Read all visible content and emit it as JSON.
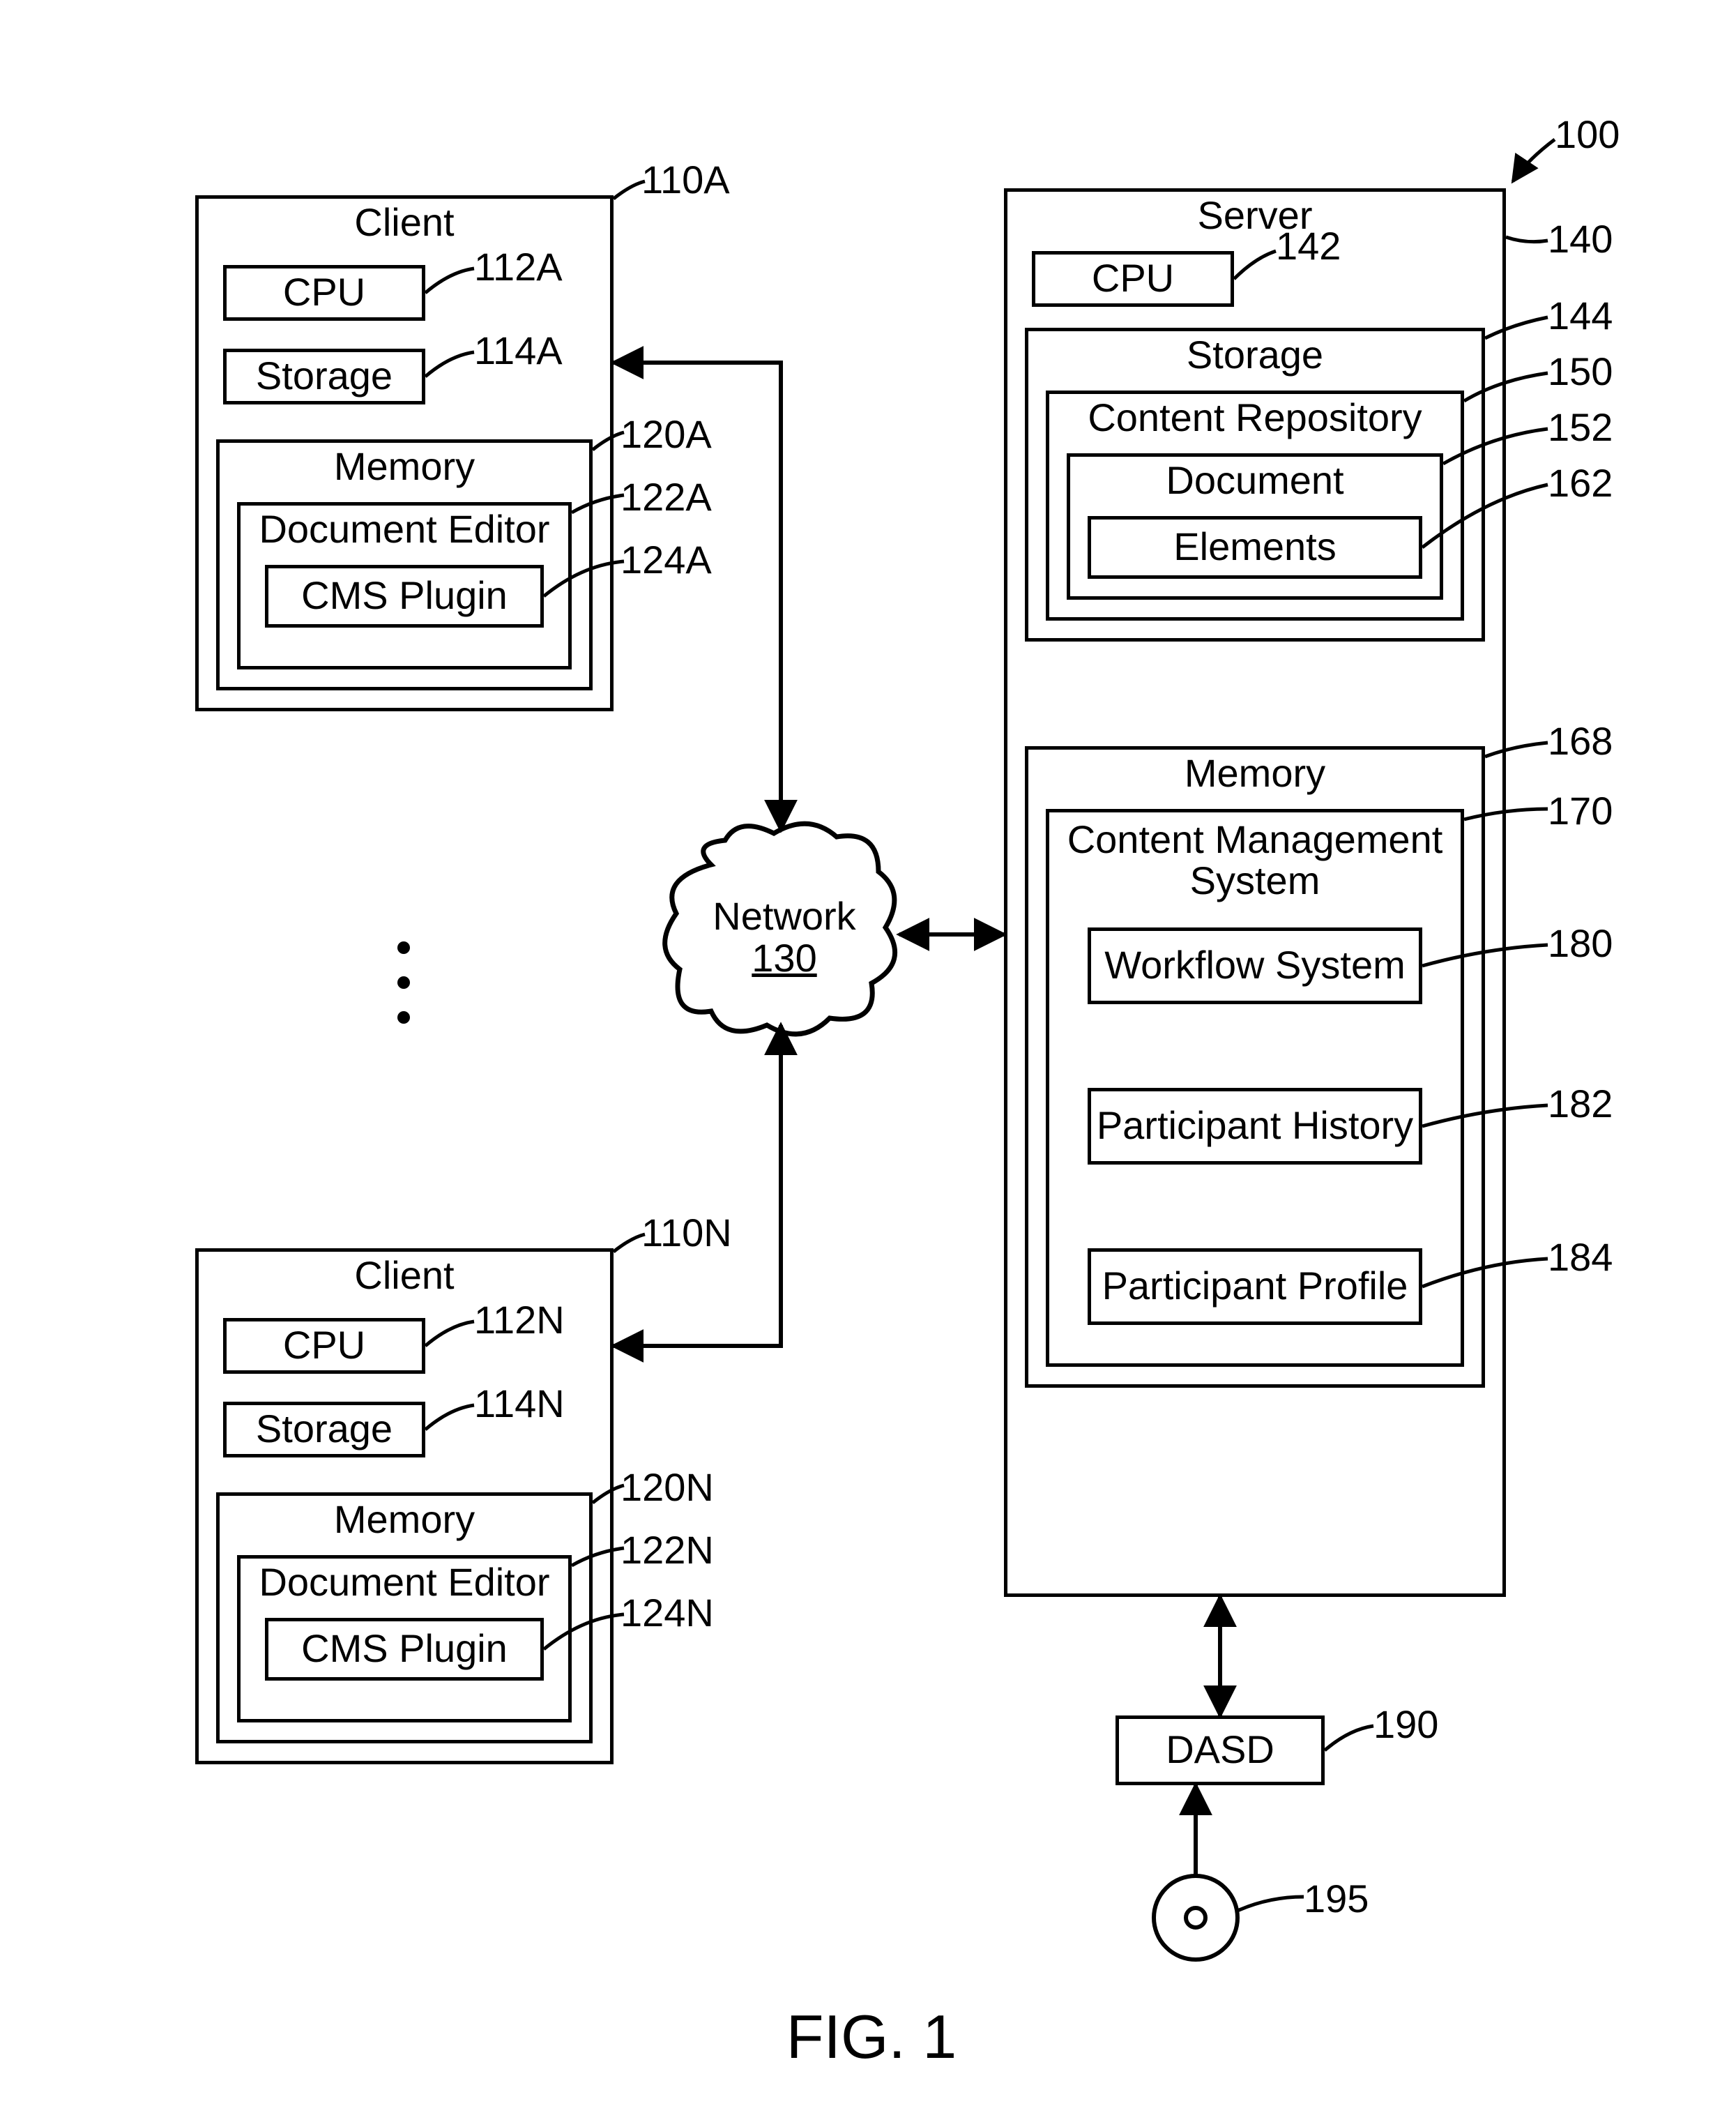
{
  "figure": "FIG. 1",
  "client": {
    "title": "Client",
    "cpu": "CPU",
    "storage": "Storage",
    "memory": "Memory",
    "docEditor": "Document Editor",
    "cmsPlugin": "CMS Plugin"
  },
  "server": {
    "title": "Server",
    "cpu": "CPU",
    "storage": "Storage",
    "repo": "Content Repository",
    "document": "Document",
    "elements": "Elements",
    "memory": "Memory",
    "cms": "Content Management\nSystem",
    "workflow": "Workflow System",
    "history": "Participant History",
    "profile": "Participant Profile"
  },
  "network": "Network",
  "networkRef": "130",
  "dasd": "DASD",
  "refs": {
    "system": "100",
    "clientA": "110A",
    "cpuA": "112A",
    "storageA": "114A",
    "memA": "120A",
    "editorA": "122A",
    "pluginA": "124A",
    "clientN": "110N",
    "cpuN": "112N",
    "storageN": "114N",
    "memN": "120N",
    "editorN": "122N",
    "pluginN": "124N",
    "server": "140",
    "srvCpu": "142",
    "srvStorage": "144",
    "repo": "150",
    "document": "152",
    "elements": "162",
    "srvMem": "168",
    "cms": "170",
    "workflow": "180",
    "history": "182",
    "profile": "184",
    "dasd": "190",
    "disc": "195"
  }
}
